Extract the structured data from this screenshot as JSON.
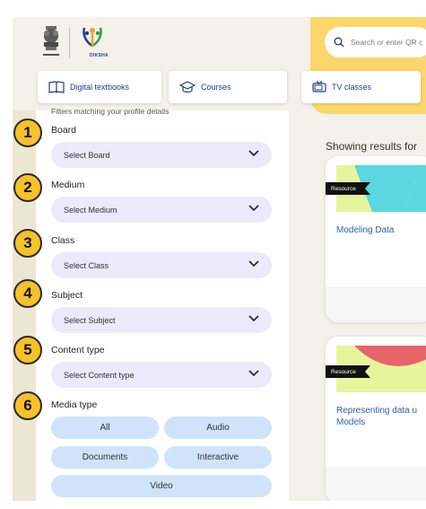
{
  "header": {
    "emblem_caption": "सत्यमेव जयते",
    "logo_text": "DIKSHA",
    "search_placeholder": "Search or enter QR c"
  },
  "nav": {
    "tabs": [
      {
        "label": "Digital textbooks",
        "icon": "book-icon"
      },
      {
        "label": "Courses",
        "icon": "graduation-cap-icon"
      },
      {
        "label": "TV classes",
        "icon": "tv-icon"
      }
    ]
  },
  "filters": {
    "hint": "Filters matching your profile details",
    "fields": [
      {
        "step": "1",
        "label": "Board",
        "placeholder": "Select Board"
      },
      {
        "step": "2",
        "label": "Medium",
        "placeholder": "Select Medium"
      },
      {
        "step": "3",
        "label": "Class",
        "placeholder": "Select Class"
      },
      {
        "step": "4",
        "label": "Subject",
        "placeholder": "Select Subject"
      },
      {
        "step": "5",
        "label": "Content type",
        "placeholder": "Select Content type"
      }
    ],
    "media": {
      "step": "6",
      "label": "Media type",
      "options": [
        "All",
        "Audio",
        "Documents",
        "Interactive",
        "Video"
      ]
    }
  },
  "results": {
    "title": "Showing results for",
    "cards": [
      {
        "tag": "Resource",
        "title": "Modeling Data"
      },
      {
        "tag": "Resource",
        "title": "Representing data u Models"
      }
    ]
  },
  "colors": {
    "accent_yellow": "#fcd66a",
    "badge_yellow": "#f6c12b",
    "select_bg": "#ece9fb",
    "pill_bg": "#cfe4fb",
    "link_blue": "#2a5fa8"
  }
}
